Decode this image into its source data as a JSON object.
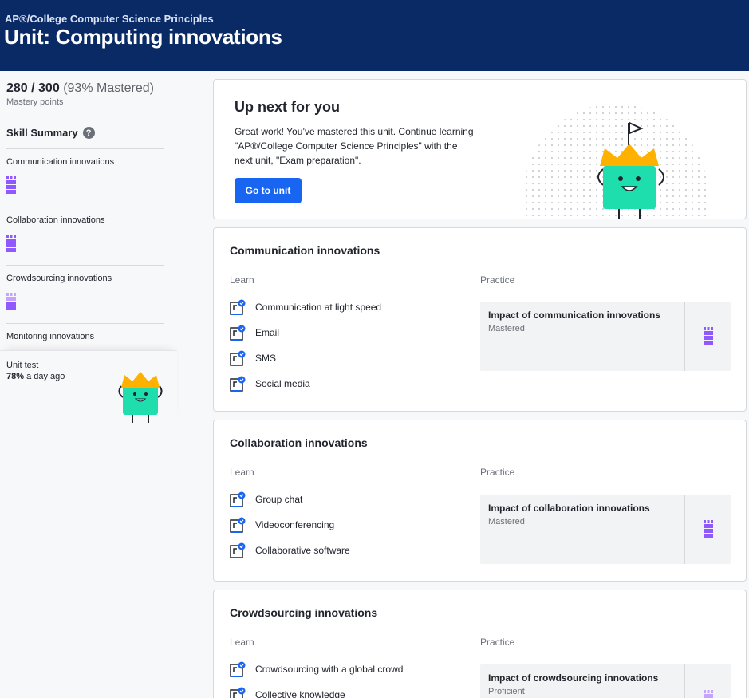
{
  "header": {
    "course": "AP®/College Computer Science Principles",
    "unit_title": "Unit: Computing innovations"
  },
  "sidebar": {
    "points": "280 / 300",
    "percent": "(93% Mastered)",
    "points_label": "Mastery points",
    "skill_summary": "Skill Summary",
    "skills": [
      {
        "name": "Communication innovations",
        "level": "mastered"
      },
      {
        "name": "Collaboration innovations",
        "level": "mastered"
      },
      {
        "name": "Crowdsourcing innovations",
        "level": "proficient"
      },
      {
        "name": "Monitoring innovations"
      }
    ],
    "unit_test": {
      "label": "Unit test",
      "score": "78%",
      "when": " a day ago"
    }
  },
  "up_next": {
    "title": "Up next for you",
    "text": "Great work! You’ve mastered this unit. Continue learning \"AP®/College Computer Science Principles\" with the next unit, \"Exam preparation\".",
    "button": "Go to unit"
  },
  "sections": [
    {
      "title": "Communication innovations",
      "learn_label": "Learn",
      "practice_label": "Practice",
      "learn": [
        "Communication at light speed",
        "Email",
        "SMS",
        "Social media"
      ],
      "practice": {
        "title": "Impact of communication innovations",
        "status": "Mastered"
      }
    },
    {
      "title": "Collaboration innovations",
      "learn_label": "Learn",
      "practice_label": "Practice",
      "learn": [
        "Group chat",
        "Videoconferencing",
        "Collaborative software"
      ],
      "practice": {
        "title": "Impact of collaboration innovations",
        "status": "Mastered"
      }
    },
    {
      "title": "Crowdsourcing innovations",
      "learn_label": "Learn",
      "practice_label": "Practice",
      "learn": [
        "Crowdsourcing with a global crowd",
        "Collective knowledge"
      ],
      "practice": {
        "title": "Impact of crowdsourcing innovations",
        "status": "Proficient"
      }
    }
  ],
  "colors": {
    "header_bg": "#0a2a66",
    "button_blue": "#1865f2",
    "mastered_purple": "#9059ff",
    "proficient_purple": "#c5a3ff",
    "mascot_green": "#1fdeae",
    "crown_gold": "#ffb100"
  }
}
